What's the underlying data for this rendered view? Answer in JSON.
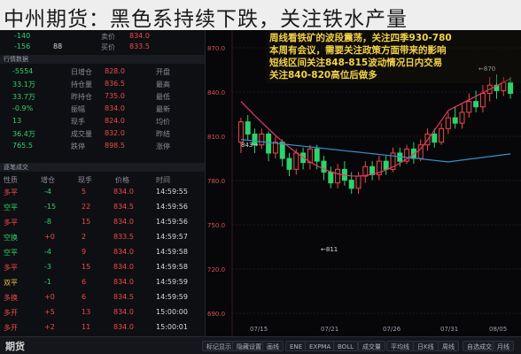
{
  "header": {
    "title": "中州期货：黑色系持续下跌，关注铁水产量"
  },
  "quote": {
    "top_rows": [
      {
        "a": "-140",
        "b": "卖价",
        "c": "834.0"
      },
      {
        "a": "-156",
        "b": "买价",
        "c": "833.5",
        "d": "88"
      }
    ],
    "section_title": "行情数据",
    "stats": [
      {
        "l": "开盘",
        "v": "828.0",
        "l2": "日增仓",
        "v2": "-5554"
      },
      {
        "l": "最高",
        "v": "836.5",
        "l2": "持仓量",
        "v2": "33.1万"
      },
      {
        "l": "最低",
        "v": "735.0",
        "l2": "昨持仓",
        "v2": "33.7万"
      },
      {
        "l": "最新",
        "v": "834.0",
        "l2": "振幅",
        "v2": "-0.9%"
      },
      {
        "l": "均价",
        "v": "824.0",
        "l2": "现手",
        "v2": "13"
      },
      {
        "l": "昨结",
        "v": "832.0",
        "l2": "成交量",
        "v2": "36.4万"
      },
      {
        "l": "涨停",
        "v": "898.5",
        "l2": "跌停",
        "v2": "765.5"
      }
    ],
    "trades_title": "逐笔成交",
    "trade_headers": [
      "时间",
      "价格",
      "现手",
      "增仓",
      "性质"
    ],
    "trades": [
      {
        "t": "14:59:55",
        "p": "834.0",
        "n": "5",
        "d": "-4",
        "k": "多平"
      },
      {
        "t": "14:59:56",
        "p": "834.5",
        "n": "22",
        "d": "-15",
        "k": "空平"
      },
      {
        "t": "14:59:56",
        "p": "834.0",
        "n": "15",
        "d": "-8",
        "k": "多平"
      },
      {
        "t": "14:59:57",
        "p": "833.5",
        "n": "2",
        "d": "+0",
        "k": "空换"
      },
      {
        "t": "14:59:58",
        "p": "834.0",
        "n": "9",
        "d": "-4",
        "k": "空平"
      },
      {
        "t": "14:59:58",
        "p": "834.0",
        "n": "15",
        "d": "-3",
        "k": "多平"
      },
      {
        "t": "14:59:59",
        "p": "834.0",
        "n": "6",
        "d": "-1",
        "k": "双平"
      },
      {
        "t": "14:59:59",
        "p": "834.5",
        "n": "6",
        "d": "+0",
        "k": "多换"
      },
      {
        "t": "15:00:00",
        "p": "834.0",
        "n": "13",
        "d": "+5",
        "k": "多开"
      },
      {
        "t": "15:00:01",
        "p": "834.0",
        "n": "11",
        "d": "+2",
        "k": "多开"
      }
    ]
  },
  "annotation": {
    "lines": [
      "周线看铁矿的波段震荡，关注四季930-780",
      "本周有会议，需要关注政策方面带来的影响",
      "短线区间关注848-815波动情况日内交易",
      "关注840-820高位后做多"
    ]
  },
  "chart": {
    "price_ticks": [
      "870.0",
      "840.0",
      "810.0",
      "780.0",
      "750.0",
      "720.0",
      "690.0"
    ],
    "marker_high": "870",
    "marker_mid": "843",
    "marker_low": "811",
    "x_ticks": [
      "07/15",
      "07/21",
      "07/26",
      "07/31",
      "08/05"
    ],
    "up_color": "#f04848",
    "down_color": "#2ed36b",
    "ma1_color": "#e23b66",
    "ma2_color": "#3a8ec7"
  },
  "bottom": {
    "label": "期货",
    "buttons": [
      "标记显示",
      "隐藏设置",
      "画线",
      "ENE",
      "EXPMA",
      "BOLL",
      "成交量",
      "平均线",
      "日K线",
      "周线",
      "自选成交",
      "月线"
    ]
  }
}
